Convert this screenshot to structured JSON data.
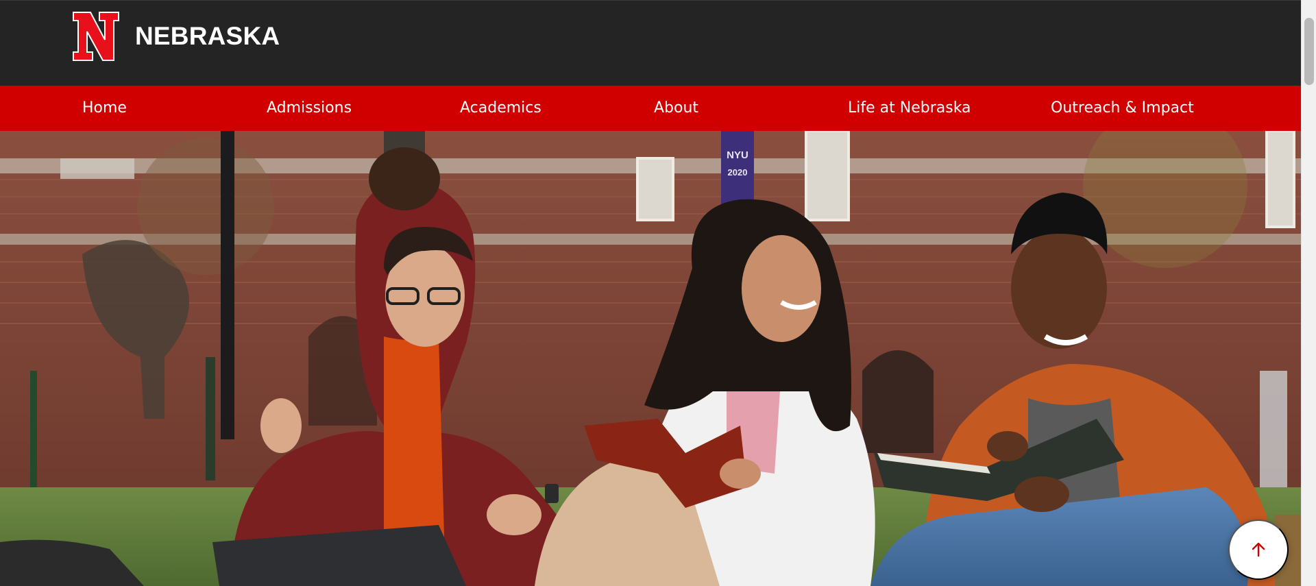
{
  "header": {
    "logo_letter": "N",
    "site_name": "NEBRASKA",
    "logo_icon": "nebraska-n-logo"
  },
  "nav": {
    "items": [
      {
        "label": "Home"
      },
      {
        "label": "Admissions"
      },
      {
        "label": "Academics"
      },
      {
        "label": "About"
      },
      {
        "label": "Life at Nebraska"
      },
      {
        "label": "Outreach & Impact"
      }
    ]
  },
  "hero": {
    "image": "students-studying-on-campus-lawn",
    "banner_text": "NYU 2020"
  },
  "back_to_top": {
    "icon": "arrow-up-icon"
  },
  "colors": {
    "header_bg": "#242424",
    "nav_bg": "#d00000",
    "nav_text": "#ffffff",
    "logo_red": "#e8101a",
    "accent_arrow": "#d00000"
  }
}
